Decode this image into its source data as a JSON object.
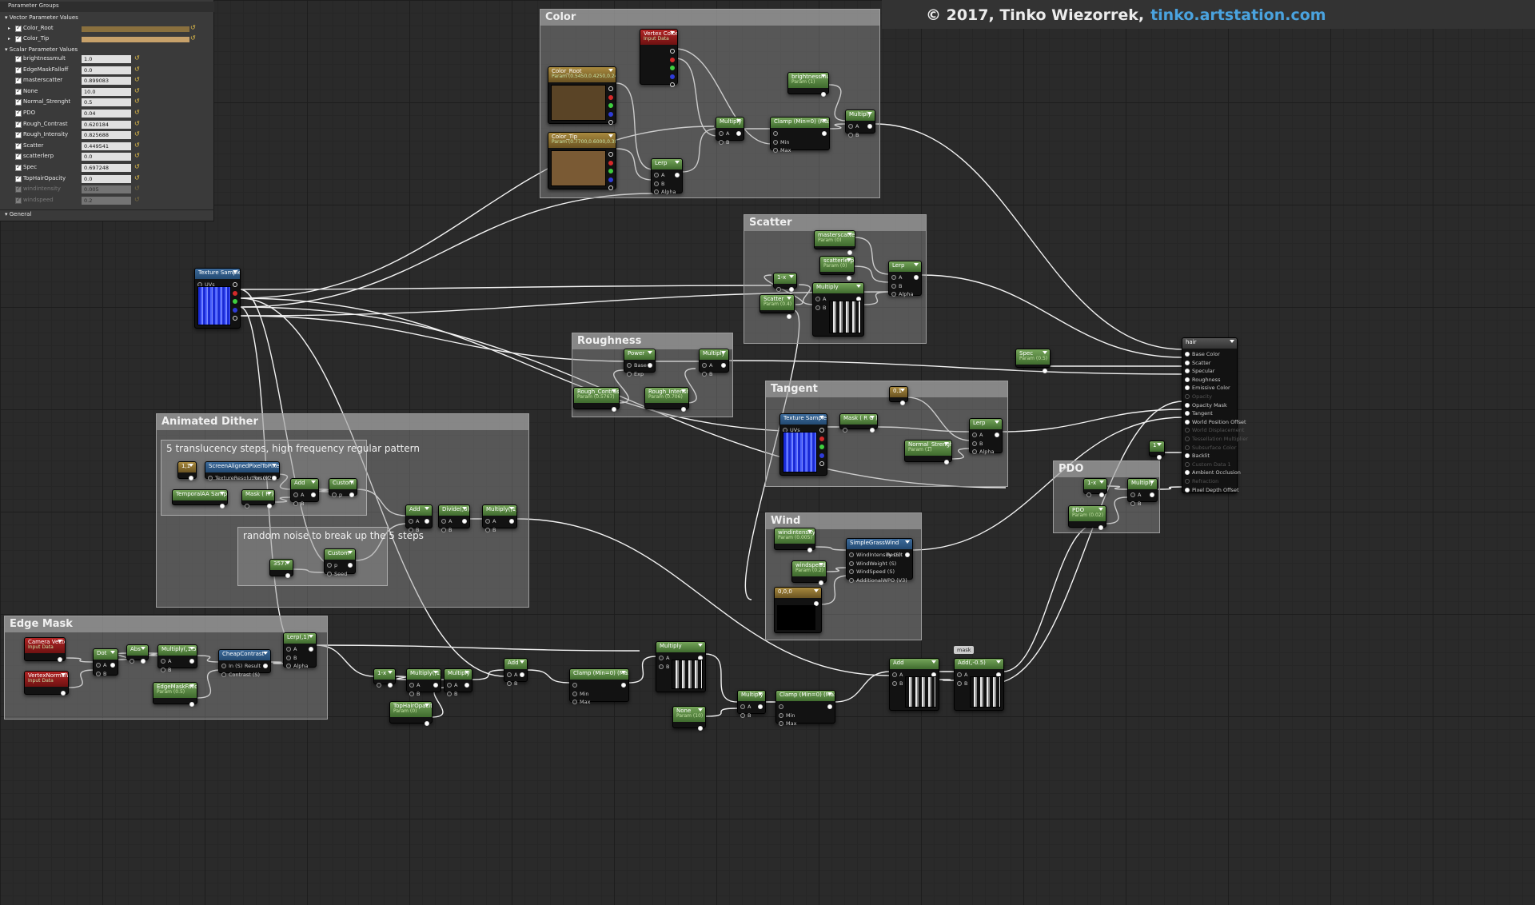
{
  "credit": {
    "prefix": "© 2017, Tinko Wiezorrek,",
    "link": "tinko.artstation.com"
  },
  "params": {
    "title": "Parameter Groups",
    "vector_title": "Vector Parameter Values",
    "vector": [
      {
        "name": "Color_Root",
        "color": "#8a703e"
      },
      {
        "name": "Color_Tip",
        "color": "#c7a16a"
      }
    ],
    "scalar_title": "Scalar Parameter Values",
    "scalar": [
      {
        "name": "brightnessmult",
        "value": "1.0",
        "enabled": true
      },
      {
        "name": "EdgeMaskFalloff",
        "value": "0.0",
        "enabled": true
      },
      {
        "name": "masterscatter",
        "value": "0.899083",
        "enabled": true
      },
      {
        "name": "None",
        "value": "10.0",
        "enabled": true
      },
      {
        "name": "Normal_Strenght",
        "value": "0.5",
        "enabled": true
      },
      {
        "name": "PDO",
        "value": "0.04",
        "enabled": true
      },
      {
        "name": "Rough_Contrast",
        "value": "0.620184",
        "enabled": true
      },
      {
        "name": "Rough_Intensity",
        "value": "0.825688",
        "enabled": true
      },
      {
        "name": "Scatter",
        "value": "0.449541",
        "enabled": true
      },
      {
        "name": "scatterlerp",
        "value": "0.0",
        "enabled": true
      },
      {
        "name": "Spec",
        "value": "0.697248",
        "enabled": true
      },
      {
        "name": "TopHairOpacity",
        "value": "0.0",
        "enabled": true
      },
      {
        "name": "windintensity",
        "value": "0.005",
        "enabled": false
      },
      {
        "name": "windspeed",
        "value": "0.2",
        "enabled": false
      }
    ],
    "general_title": "General"
  },
  "comments": [
    {
      "id": "color",
      "title": "Color"
    },
    {
      "id": "scatter",
      "title": "Scatter"
    },
    {
      "id": "roughness",
      "title": "Roughness"
    },
    {
      "id": "tangent",
      "title": "Tangent"
    },
    {
      "id": "wind",
      "title": "Wind"
    },
    {
      "id": "pdo",
      "title": "PDO"
    },
    {
      "id": "dither",
      "title": "Animated Dither"
    },
    {
      "id": "steps",
      "title": "5 translucency steps, high frequency regular pattern"
    },
    {
      "id": "noise",
      "title": "random noise to break up the 5 steps"
    },
    {
      "id": "edge",
      "title": "Edge Mask"
    }
  ],
  "nodes": [
    {
      "id": "vertexcolor",
      "title": "Vertex Color",
      "sub": "Input Data",
      "color": "r",
      "pins_out": [
        "",
        "",
        "",
        "",
        ""
      ]
    },
    {
      "id": "color_root",
      "title": "Color_Root",
      "sub": "Param (0.5450,0.4250,0.2400,1)",
      "color": "y",
      "preview": "#5a4426",
      "pins_out": [
        "",
        "",
        "",
        "",
        ""
      ]
    },
    {
      "id": "color_tip",
      "title": "Color_Tip",
      "sub": "Param (0.7700,0.6000,0.3800,1)",
      "color": "y",
      "preview": "#7a5a34",
      "pins_out": [
        "",
        "",
        "",
        "",
        ""
      ]
    },
    {
      "id": "lerp_color",
      "title": "Lerp",
      "color": "g",
      "pins_in": [
        "A",
        "B",
        "Alpha"
      ],
      "pins_out": [
        ""
      ]
    },
    {
      "id": "multiply_color",
      "title": "Multiply",
      "color": "g",
      "pins_in": [
        "A",
        "B"
      ],
      "pins_out": [
        ""
      ]
    },
    {
      "id": "clamp_color",
      "title": "Clamp (Min=0) (Max=1)",
      "color": "g",
      "pins_in": [
        "",
        "Min",
        "Max"
      ],
      "pins_out": [
        ""
      ]
    },
    {
      "id": "brightnessmult",
      "title": "brightnessmult",
      "sub": "Param (1)",
      "color": "g",
      "pins_out": [
        ""
      ]
    },
    {
      "id": "multiply_bright",
      "title": "Multiply",
      "color": "g",
      "pins_in": [
        "A",
        "B"
      ],
      "pins_out": [
        ""
      ]
    },
    {
      "id": "texsample1",
      "title": "Texture Sample",
      "color": "b",
      "pins_in": [
        "UVs",
        "Tex"
      ],
      "pins_out": [
        "",
        "",
        "",
        "",
        ""
      ],
      "preview": "tex"
    },
    {
      "id": "masterscatter",
      "title": "masterscatter",
      "sub": "Param (0)",
      "color": "g",
      "pins_out": [
        ""
      ]
    },
    {
      "id": "scatterlerp",
      "title": "scatterlerp",
      "sub": "Param (0)",
      "color": "g",
      "pins_out": [
        ""
      ]
    },
    {
      "id": "oneminus_sc",
      "title": "1-x",
      "color": "g",
      "pins_in": [
        ""
      ],
      "pins_out": [
        ""
      ]
    },
    {
      "id": "scatter",
      "title": "Scatter",
      "sub": "Param (0.4)",
      "color": "g",
      "pins_out": [
        ""
      ]
    },
    {
      "id": "multiply_sc",
      "title": "Multiply",
      "color": "g",
      "pins_in": [
        "A",
        "B"
      ],
      "pins_out": [
        ""
      ],
      "preview": "mask"
    },
    {
      "id": "lerp_sc",
      "title": "Lerp",
      "color": "g",
      "pins_in": [
        "A",
        "B",
        "Alpha"
      ],
      "pins_out": [
        ""
      ]
    },
    {
      "id": "power",
      "title": "Power",
      "color": "g",
      "pins_in": [
        "Base",
        "Exp"
      ],
      "pins_out": [
        ""
      ]
    },
    {
      "id": "multiply_rough",
      "title": "Multiply",
      "color": "g",
      "pins_in": [
        "A",
        "B"
      ],
      "pins_out": [
        ""
      ]
    },
    {
      "id": "rough_contrast",
      "title": "Rough_Contrast",
      "sub": "Param (0.5767)",
      "color": "g",
      "pins_out": [
        ""
      ]
    },
    {
      "id": "rough_intensity",
      "title": "Rough_Intensity",
      "sub": "Param (0.706)",
      "color": "g",
      "pins_out": [
        ""
      ]
    },
    {
      "id": "spec",
      "title": "Spec",
      "sub": "Param (0.5)",
      "color": "g",
      "pins_out": [
        ""
      ]
    },
    {
      "id": "const01",
      "title": "0.1",
      "color": "y",
      "pins_out": [
        ""
      ]
    },
    {
      "id": "texsample2",
      "title": "Texture Sample",
      "color": "b",
      "pins_in": [
        "UVs",
        "Tex"
      ],
      "pins_out": [
        "",
        "",
        "",
        "",
        ""
      ],
      "preview": "tex"
    },
    {
      "id": "mask_rg",
      "title": "Mask ( R G )",
      "color": "g",
      "pins_in": [
        ""
      ],
      "pins_out": [
        ""
      ]
    },
    {
      "id": "normal_strenght",
      "title": "Normal_Strenght",
      "sub": "Param (1)",
      "color": "g",
      "pins_out": [
        ""
      ]
    },
    {
      "id": "lerp_tan",
      "title": "Lerp",
      "color": "g",
      "pins_in": [
        "A",
        "B",
        "Alpha"
      ],
      "pins_out": [
        ""
      ]
    },
    {
      "id": "const1",
      "title": "1",
      "color": "g",
      "pins_out": [
        ""
      ]
    },
    {
      "id": "oneminus_pdo",
      "title": "1-x",
      "color": "g",
      "pins_in": [
        ""
      ],
      "pins_out": [
        ""
      ]
    },
    {
      "id": "pdo",
      "title": "PDO",
      "sub": "Param (0.02)",
      "color": "g",
      "pins_out": [
        ""
      ]
    },
    {
      "id": "multiply_pdo",
      "title": "Multiply",
      "color": "g",
      "pins_in": [
        "A",
        "B"
      ],
      "pins_out": [
        ""
      ]
    },
    {
      "id": "windintensity",
      "title": "windintensity",
      "sub": "Param (0.005)",
      "color": "g",
      "pins_out": [
        ""
      ]
    },
    {
      "id": "windspeed",
      "title": "windspeed",
      "sub": "Param (0.2)",
      "color": "g",
      "pins_out": [
        ""
      ]
    },
    {
      "id": "const000",
      "title": "0,0,0",
      "color": "y",
      "preview": "#000",
      "pins_out": [
        ""
      ]
    },
    {
      "id": "simplegrasswind",
      "title": "SimpleGrassWind",
      "color": "b",
      "pins_in": [
        "WindIntensity (S)",
        "WindWeight (S)",
        "WindSpeed (S)",
        "AdditionalWPO (V3)"
      ],
      "pins_out": [
        "Result"
      ]
    },
    {
      "id": "const11",
      "title": "1,1",
      "color": "y",
      "pins_out": [
        ""
      ]
    },
    {
      "id": "screenaligned",
      "title": "ScreenAlignedPixelToPixelUVs",
      "color": "b",
      "pins_in": [
        "TextureResolution (V2)"
      ],
      "pins_out": [
        "Result"
      ]
    },
    {
      "id": "temporalaa",
      "title": "TemporalAA SampleID",
      "color": "g",
      "pins_out": [
        ""
      ]
    },
    {
      "id": "mask_r1",
      "title": "Mask ( R )",
      "color": "g",
      "pins_in": [
        ""
      ],
      "pins_out": [
        ""
      ]
    },
    {
      "id": "add_d1",
      "title": "Add",
      "color": "g",
      "pins_in": [
        "A",
        "B"
      ],
      "pins_out": [
        ""
      ]
    },
    {
      "id": "custom1",
      "title": "Custom",
      "color": "g",
      "pins_in": [
        "p"
      ],
      "pins_out": [
        ""
      ]
    },
    {
      "id": "add_d2",
      "title": "Add",
      "color": "g",
      "pins_in": [
        "A",
        "B"
      ],
      "pins_out": [
        ""
      ]
    },
    {
      "id": "divide",
      "title": "Divide(,6)",
      "color": "g",
      "pins_in": [
        "A",
        "B"
      ],
      "pins_out": [
        ""
      ]
    },
    {
      "id": "multiply_d",
      "title": "Multiply(,1)",
      "color": "g",
      "pins_in": [
        "A",
        "B"
      ],
      "pins_out": [
        ""
      ]
    },
    {
      "id": "custom2",
      "title": "Custom",
      "color": "g",
      "pins_in": [
        "p",
        "Seed"
      ],
      "pins_out": [
        ""
      ]
    },
    {
      "id": "const3577",
      "title": "3577",
      "color": "g",
      "pins_out": [
        ""
      ]
    },
    {
      "id": "cameravector",
      "title": "Camera Vector",
      "sub": "Input Data",
      "color": "r",
      "pins_out": [
        ""
      ]
    },
    {
      "id": "vertexnormal",
      "title": "VertexNormalWS",
      "sub": "Input Data",
      "color": "r",
      "pins_out": [
        ""
      ]
    },
    {
      "id": "dot",
      "title": "Dot",
      "color": "g",
      "pins_in": [
        "A",
        "B"
      ],
      "pins_out": [
        ""
      ]
    },
    {
      "id": "abs",
      "title": "Abs",
      "color": "g",
      "pins_in": [
        ""
      ],
      "pins_out": [
        ""
      ]
    },
    {
      "id": "multiply15",
      "title": "Multiply(,1.5)",
      "color": "g",
      "pins_in": [
        "A",
        "B"
      ],
      "pins_out": [
        ""
      ]
    },
    {
      "id": "cheapcontrast",
      "title": "CheapContrast",
      "color": "b",
      "pins_in": [
        "In (S)",
        "Contrast (S)"
      ],
      "pins_out": [
        "Result"
      ]
    },
    {
      "id": "edgemaskfalloff",
      "title": "EdgeMaskFalloff",
      "sub": "Param (0.5)",
      "color": "g",
      "pins_out": [
        ""
      ]
    },
    {
      "id": "lerp_edge",
      "title": "Lerp(,1)",
      "color": "g",
      "pins_in": [
        "A",
        "B",
        "Alpha"
      ],
      "pins_out": [
        ""
      ]
    },
    {
      "id": "oneminus_e",
      "title": "1-x",
      "color": "g",
      "pins_in": [
        ""
      ],
      "pins_out": [
        ""
      ]
    },
    {
      "id": "multiply_e1",
      "title": "Multiply(,1)",
      "color": "g",
      "pins_in": [
        "A",
        "B"
      ],
      "pins_out": [
        ""
      ]
    },
    {
      "id": "multiply_e2",
      "title": "Multiply",
      "color": "g",
      "pins_in": [
        "A",
        "B"
      ],
      "pins_out": [
        ""
      ]
    },
    {
      "id": "tophairopacity",
      "title": "TopHairOpacity",
      "sub": "Param (0)",
      "color": "g",
      "pins_out": [
        ""
      ]
    },
    {
      "id": "add_e",
      "title": "Add",
      "color": "g",
      "pins_in": [
        "A",
        "B"
      ],
      "pins_out": [
        ""
      ]
    },
    {
      "id": "clamp_e",
      "title": "Clamp (Min=0) (Max=1)",
      "color": "g",
      "pins_in": [
        "",
        "Min",
        "Max"
      ],
      "pins_out": [
        ""
      ]
    },
    {
      "id": "multiply_e3",
      "title": "Multiply",
      "color": "g",
      "pins_in": [
        "A",
        "B"
      ],
      "pins_out": [
        ""
      ],
      "preview": "mask"
    },
    {
      "id": "multiply_e4",
      "title": "Multiply",
      "color": "g",
      "pins_in": [
        "A",
        "B"
      ],
      "pins_out": [
        ""
      ]
    },
    {
      "id": "none_param",
      "title": "None",
      "sub": "Param (10)",
      "color": "g",
      "pins_out": [
        ""
      ]
    },
    {
      "id": "clamp_e2",
      "title": "Clamp (Min=0) (Max=1)",
      "color": "g",
      "pins_in": [
        "",
        "Min",
        "Max"
      ],
      "pins_out": [
        ""
      ]
    },
    {
      "id": "add_f",
      "title": "Add",
      "color": "g",
      "pins_in": [
        "A",
        "B"
      ],
      "pins_out": [
        ""
      ],
      "preview": "mask"
    },
    {
      "id": "add_f2",
      "title": "Add(,-0.5)",
      "color": "g",
      "pins_in": [
        "A",
        "B"
      ],
      "pins_out": [
        ""
      ],
      "preview": "mask"
    },
    {
      "id": "hair",
      "title": "hair",
      "color": "k",
      "pins_in": [
        "Base Color",
        "Scatter",
        "Specular",
        "Roughness",
        "Emissive Color",
        "Opacity",
        "Opacity Mask",
        "Tangent",
        "World Position Offset",
        "World Displacement",
        "Tessellation Multiplier",
        "Subsurface Color",
        "Backlit",
        "Custom Data 1",
        "Ambient Occlusion",
        "Refraction",
        "Pixel Depth Offset"
      ],
      "pins_in_enabled": [
        true,
        true,
        true,
        true,
        true,
        false,
        true,
        true,
        true,
        false,
        false,
        false,
        true,
        false,
        true,
        false,
        true
      ]
    }
  ],
  "mask_label": "mask"
}
